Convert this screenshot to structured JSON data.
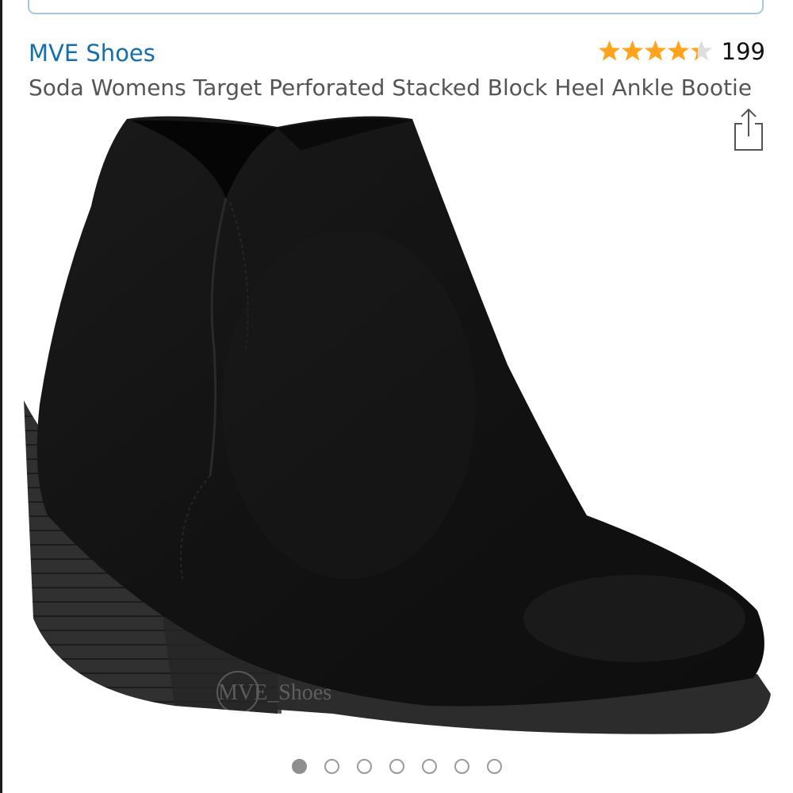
{
  "product": {
    "brand": "MVE Shoes",
    "title": "Soda Womens Target Perforated Stacked Block Heel Ankle Bootie",
    "rating_stars": 4.3,
    "review_count": "199",
    "watermark": "MVE_Shoes"
  },
  "icons": {
    "share": "share-icon",
    "star": "star-icon"
  },
  "colors": {
    "brand_link": "#136fae",
    "star_fill": "#ffa41c",
    "star_empty": "#dedede",
    "boot": "#141414"
  },
  "gallery": {
    "total_images": 7,
    "active_index": 1
  }
}
